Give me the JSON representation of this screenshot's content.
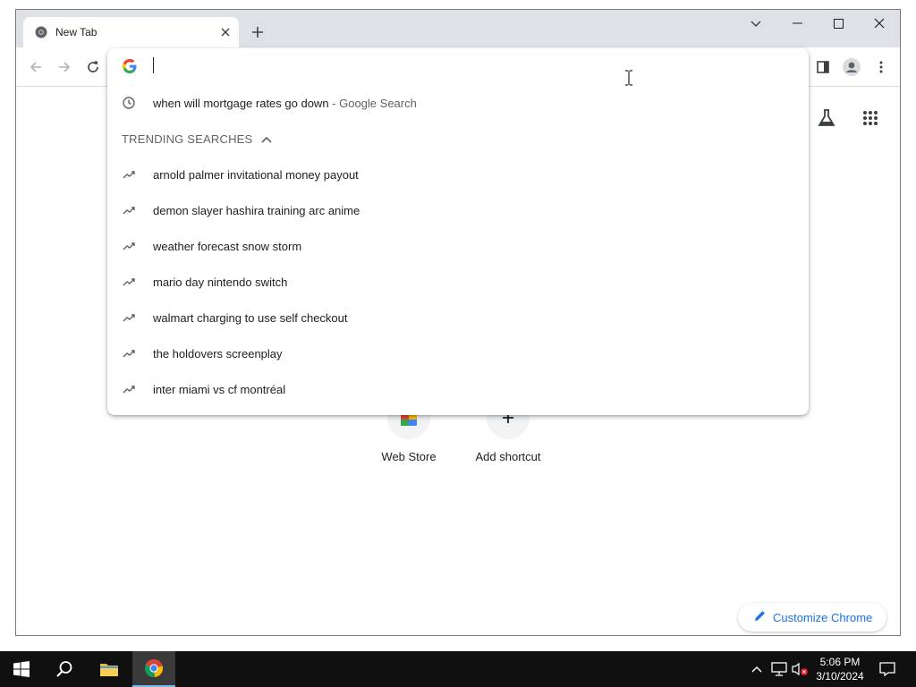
{
  "browser": {
    "tab_title": "New Tab",
    "omnibox_value": ""
  },
  "omnibox": {
    "history": {
      "query": "when will mortgage rates go down",
      "suffix": " - Google Search"
    },
    "trending_header": "TRENDING SEARCHES",
    "trending": [
      "arnold palmer invitational money payout",
      "demon slayer hashira training arc anime",
      "weather forecast snow storm",
      "mario day nintendo switch",
      "walmart charging to use self checkout",
      "the holdovers screenplay",
      "inter miami vs cf montréal"
    ]
  },
  "ntp": {
    "shortcuts": [
      {
        "label": "Web Store",
        "icon": "web-store-icon"
      },
      {
        "label": "Add shortcut",
        "icon": "plus-icon"
      }
    ],
    "customize_label": "Customize Chrome"
  },
  "taskbar": {
    "time": "5:06 PM",
    "date": "3/10/2024"
  },
  "colors": {
    "accent": "#1a73e8",
    "tabstrip": "#dee1e6",
    "taskbar": "#101010"
  }
}
